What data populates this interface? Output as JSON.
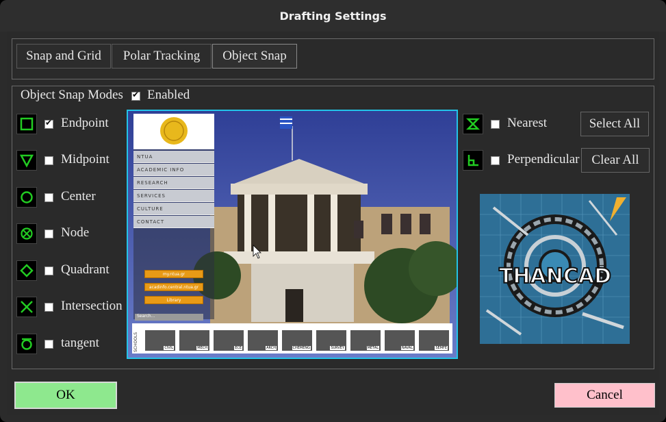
{
  "window": {
    "title": "Drafting Settings"
  },
  "tabs": [
    {
      "label": "Snap and Grid",
      "active": false
    },
    {
      "label": "Polar Tracking",
      "active": false
    },
    {
      "label": "Object Snap",
      "active": true
    }
  ],
  "object_snap": {
    "modes_label": "Object Snap Modes",
    "enabled_label": "Enabled",
    "enabled": true,
    "left_modes": [
      {
        "label": "Endpoint",
        "checked": true,
        "icon": "endpoint-square-icon"
      },
      {
        "label": "Midpoint",
        "checked": false,
        "icon": "midpoint-triangle-icon"
      },
      {
        "label": "Center",
        "checked": false,
        "icon": "center-circle-icon"
      },
      {
        "label": "Node",
        "checked": false,
        "icon": "node-circle-x-icon"
      },
      {
        "label": "Quadrant",
        "checked": false,
        "icon": "quadrant-diamond-icon"
      },
      {
        "label": "Intersection",
        "checked": false,
        "icon": "intersection-x-icon"
      },
      {
        "label": "tangent",
        "checked": false,
        "icon": "tangent-circle-icon"
      }
    ],
    "right_modes": [
      {
        "label": "Nearest",
        "checked": false,
        "icon": "nearest-hourglass-icon"
      },
      {
        "label": "Perpendicular",
        "checked": false,
        "icon": "perpendicular-icon"
      }
    ],
    "select_all_label": "Select All",
    "clear_all_label": "Clear All"
  },
  "preview_site": {
    "menu": [
      "NTUA",
      "ACADEMIC INFO",
      "RESEARCH",
      "SERVICES",
      "CULTURE",
      "CONTACT"
    ],
    "links": [
      "my.ntua.gr",
      "acadinfo.central.ntua.gr",
      "Library"
    ],
    "search_placeholder": "Search...",
    "schools_label": "SCHOOLS",
    "schools": [
      "CIVIL",
      "MECH",
      "ECE",
      "ARCH",
      "CHEMENG",
      "SURVEY",
      "METAL",
      "NAVAL",
      "SEMFE"
    ]
  },
  "logo": {
    "text": "THANCAD"
  },
  "footer": {
    "ok_label": "OK",
    "cancel_label": "Cancel"
  },
  "colors": {
    "snap_icon_green": "#22cc22",
    "preview_border": "#23c4e8",
    "ok_bg": "#8ee88e",
    "cancel_bg": "#ffc0cb"
  }
}
